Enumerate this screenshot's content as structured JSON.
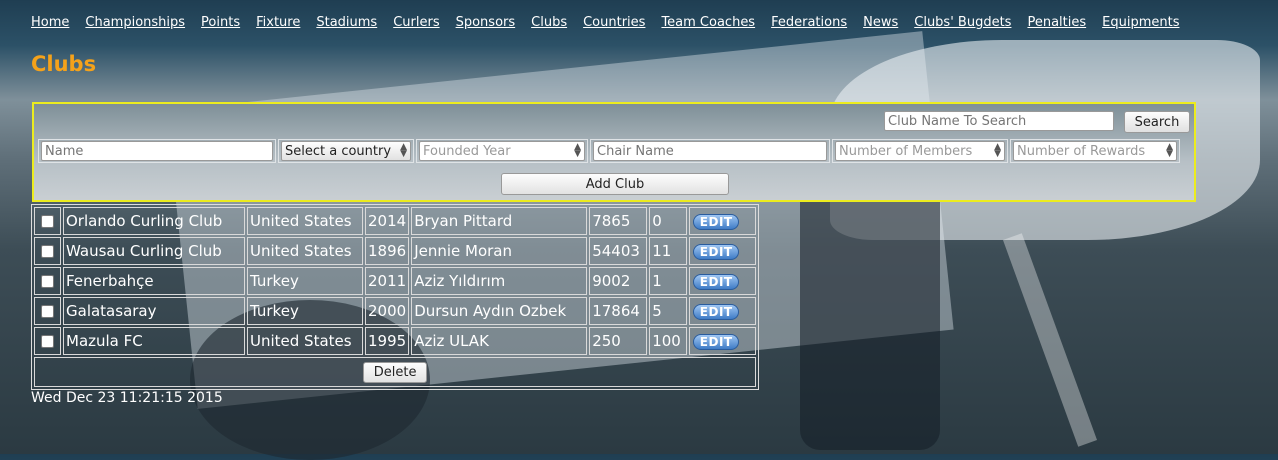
{
  "nav": [
    "Home",
    "Championships",
    "Points",
    "Fixture",
    "Stadiums",
    "Curlers",
    "Sponsors",
    "Clubs",
    "Countries",
    "Team Coaches",
    "Federations",
    "News",
    "Clubs' Bugdets",
    "Penalties",
    "Equipments"
  ],
  "page_title": "Clubs",
  "search": {
    "placeholder": "Club Name To Search",
    "button_label": "Search"
  },
  "form": {
    "name_placeholder": "Name",
    "country_select": "Select a country",
    "founded_placeholder": "Founded Year",
    "chair_placeholder": "Chair Name",
    "members_placeholder": "Number of Members",
    "rewards_placeholder": "Number of Rewards",
    "add_label": "Add Club"
  },
  "clubs": [
    {
      "name": "Orlando Curling Club",
      "country": "United States",
      "founded": "2014",
      "chair": "Bryan Pittard",
      "members": "7865",
      "rewards": "0"
    },
    {
      "name": "Wausau Curling Club",
      "country": "United States",
      "founded": "1896",
      "chair": "Jennie Moran",
      "members": "54403",
      "rewards": "11"
    },
    {
      "name": "Fenerbahçe",
      "country": "Turkey",
      "founded": "2011",
      "chair": "Aziz Yıldırım",
      "members": "9002",
      "rewards": "1"
    },
    {
      "name": "Galatasaray",
      "country": "Turkey",
      "founded": "2000",
      "chair": "Dursun Aydın Ozbek",
      "members": "17864",
      "rewards": "5"
    },
    {
      "name": "Mazula FC",
      "country": "United States",
      "founded": "1995",
      "chair": "Aziz ULAK",
      "members": "250",
      "rewards": "100"
    }
  ],
  "edit_label": "EDIT",
  "delete_label": "Delete",
  "timestamp": "Wed Dec 23 11:21:15 2015",
  "colors": {
    "title": "#f5a21a",
    "form_border": "#ecec1e",
    "edit_button": "#3f7cc6"
  }
}
